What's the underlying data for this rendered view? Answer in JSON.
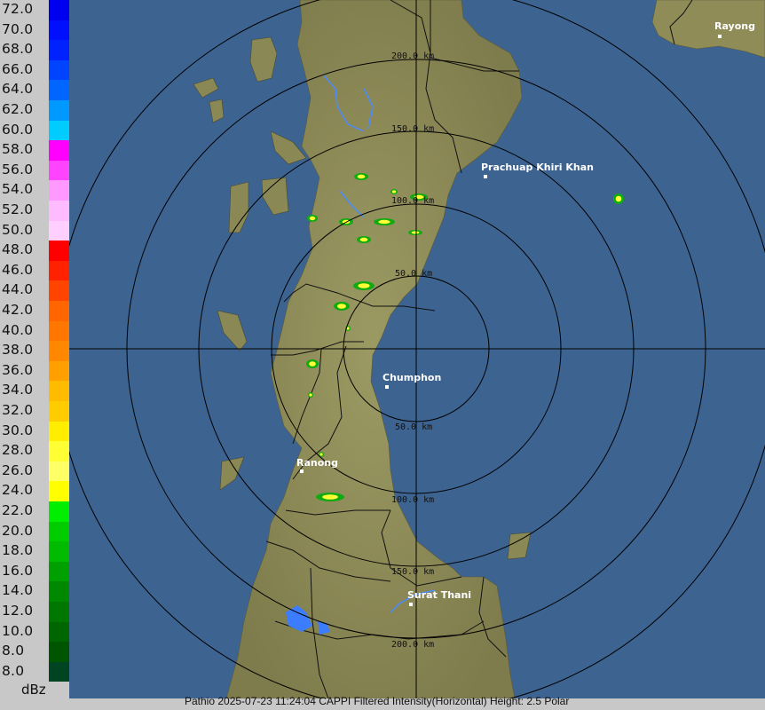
{
  "legend": {
    "unit": "dBz",
    "levels": [
      {
        "label": "72.0",
        "color": "#0000f0"
      },
      {
        "label": "70.0",
        "color": "#0010ff"
      },
      {
        "label": "68.0",
        "color": "#0022ff"
      },
      {
        "label": "66.0",
        "color": "#0044ff"
      },
      {
        "label": "64.0",
        "color": "#0066ff"
      },
      {
        "label": "62.0",
        "color": "#0099ff"
      },
      {
        "label": "60.0",
        "color": "#00ccff"
      },
      {
        "label": "58.0",
        "color": "#ff00ff"
      },
      {
        "label": "56.0",
        "color": "#ff44ff"
      },
      {
        "label": "54.0",
        "color": "#ff99ff"
      },
      {
        "label": "52.0",
        "color": "#ffbbff"
      },
      {
        "label": "50.0",
        "color": "#ffd0ff"
      },
      {
        "label": "48.0",
        "color": "#ff0000"
      },
      {
        "label": "46.0",
        "color": "#ff2200"
      },
      {
        "label": "44.0",
        "color": "#ff4400"
      },
      {
        "label": "42.0",
        "color": "#ff6600"
      },
      {
        "label": "40.0",
        "color": "#ff7700"
      },
      {
        "label": "38.0",
        "color": "#ff8800"
      },
      {
        "label": "36.0",
        "color": "#ffa000"
      },
      {
        "label": "34.0",
        "color": "#ffbb00"
      },
      {
        "label": "32.0",
        "color": "#ffcc00"
      },
      {
        "label": "30.0",
        "color": "#ffee00"
      },
      {
        "label": "28.0",
        "color": "#ffff33"
      },
      {
        "label": "26.0",
        "color": "#ffff66"
      },
      {
        "label": "24.0",
        "color": "#ffff00"
      },
      {
        "label": "22.0",
        "color": "#00ee00"
      },
      {
        "label": "20.0",
        "color": "#00cc00"
      },
      {
        "label": "18.0",
        "color": "#00bb00"
      },
      {
        "label": "16.0",
        "color": "#00a000"
      },
      {
        "label": "14.0",
        "color": "#008800"
      },
      {
        "label": "12.0",
        "color": "#007700"
      },
      {
        "label": "10.0",
        "color": "#006600"
      },
      {
        "label": "8.0",
        "color": "#005500"
      },
      {
        "label": "8.0",
        "color": "#004422"
      }
    ]
  },
  "map": {
    "cities": [
      {
        "name": "Rayong"
      },
      {
        "name": "Prachuap Khiri Khan"
      },
      {
        "name": "Chumphon"
      },
      {
        "name": "Ranong"
      },
      {
        "name": "Surat Thani"
      }
    ],
    "range_labels": {
      "north": [
        "50.0 km",
        "100.0 km",
        "150.0 km",
        "200.0 km"
      ],
      "south": [
        "50.0 km",
        "100.0 km",
        "150.0 km",
        "200.0 km"
      ]
    }
  },
  "footer": {
    "text": "Pathio 2025-07-23 11:24:04 CAPPI Filtered Intensity(Horizontal)  Height: 2.5 Polar"
  }
}
